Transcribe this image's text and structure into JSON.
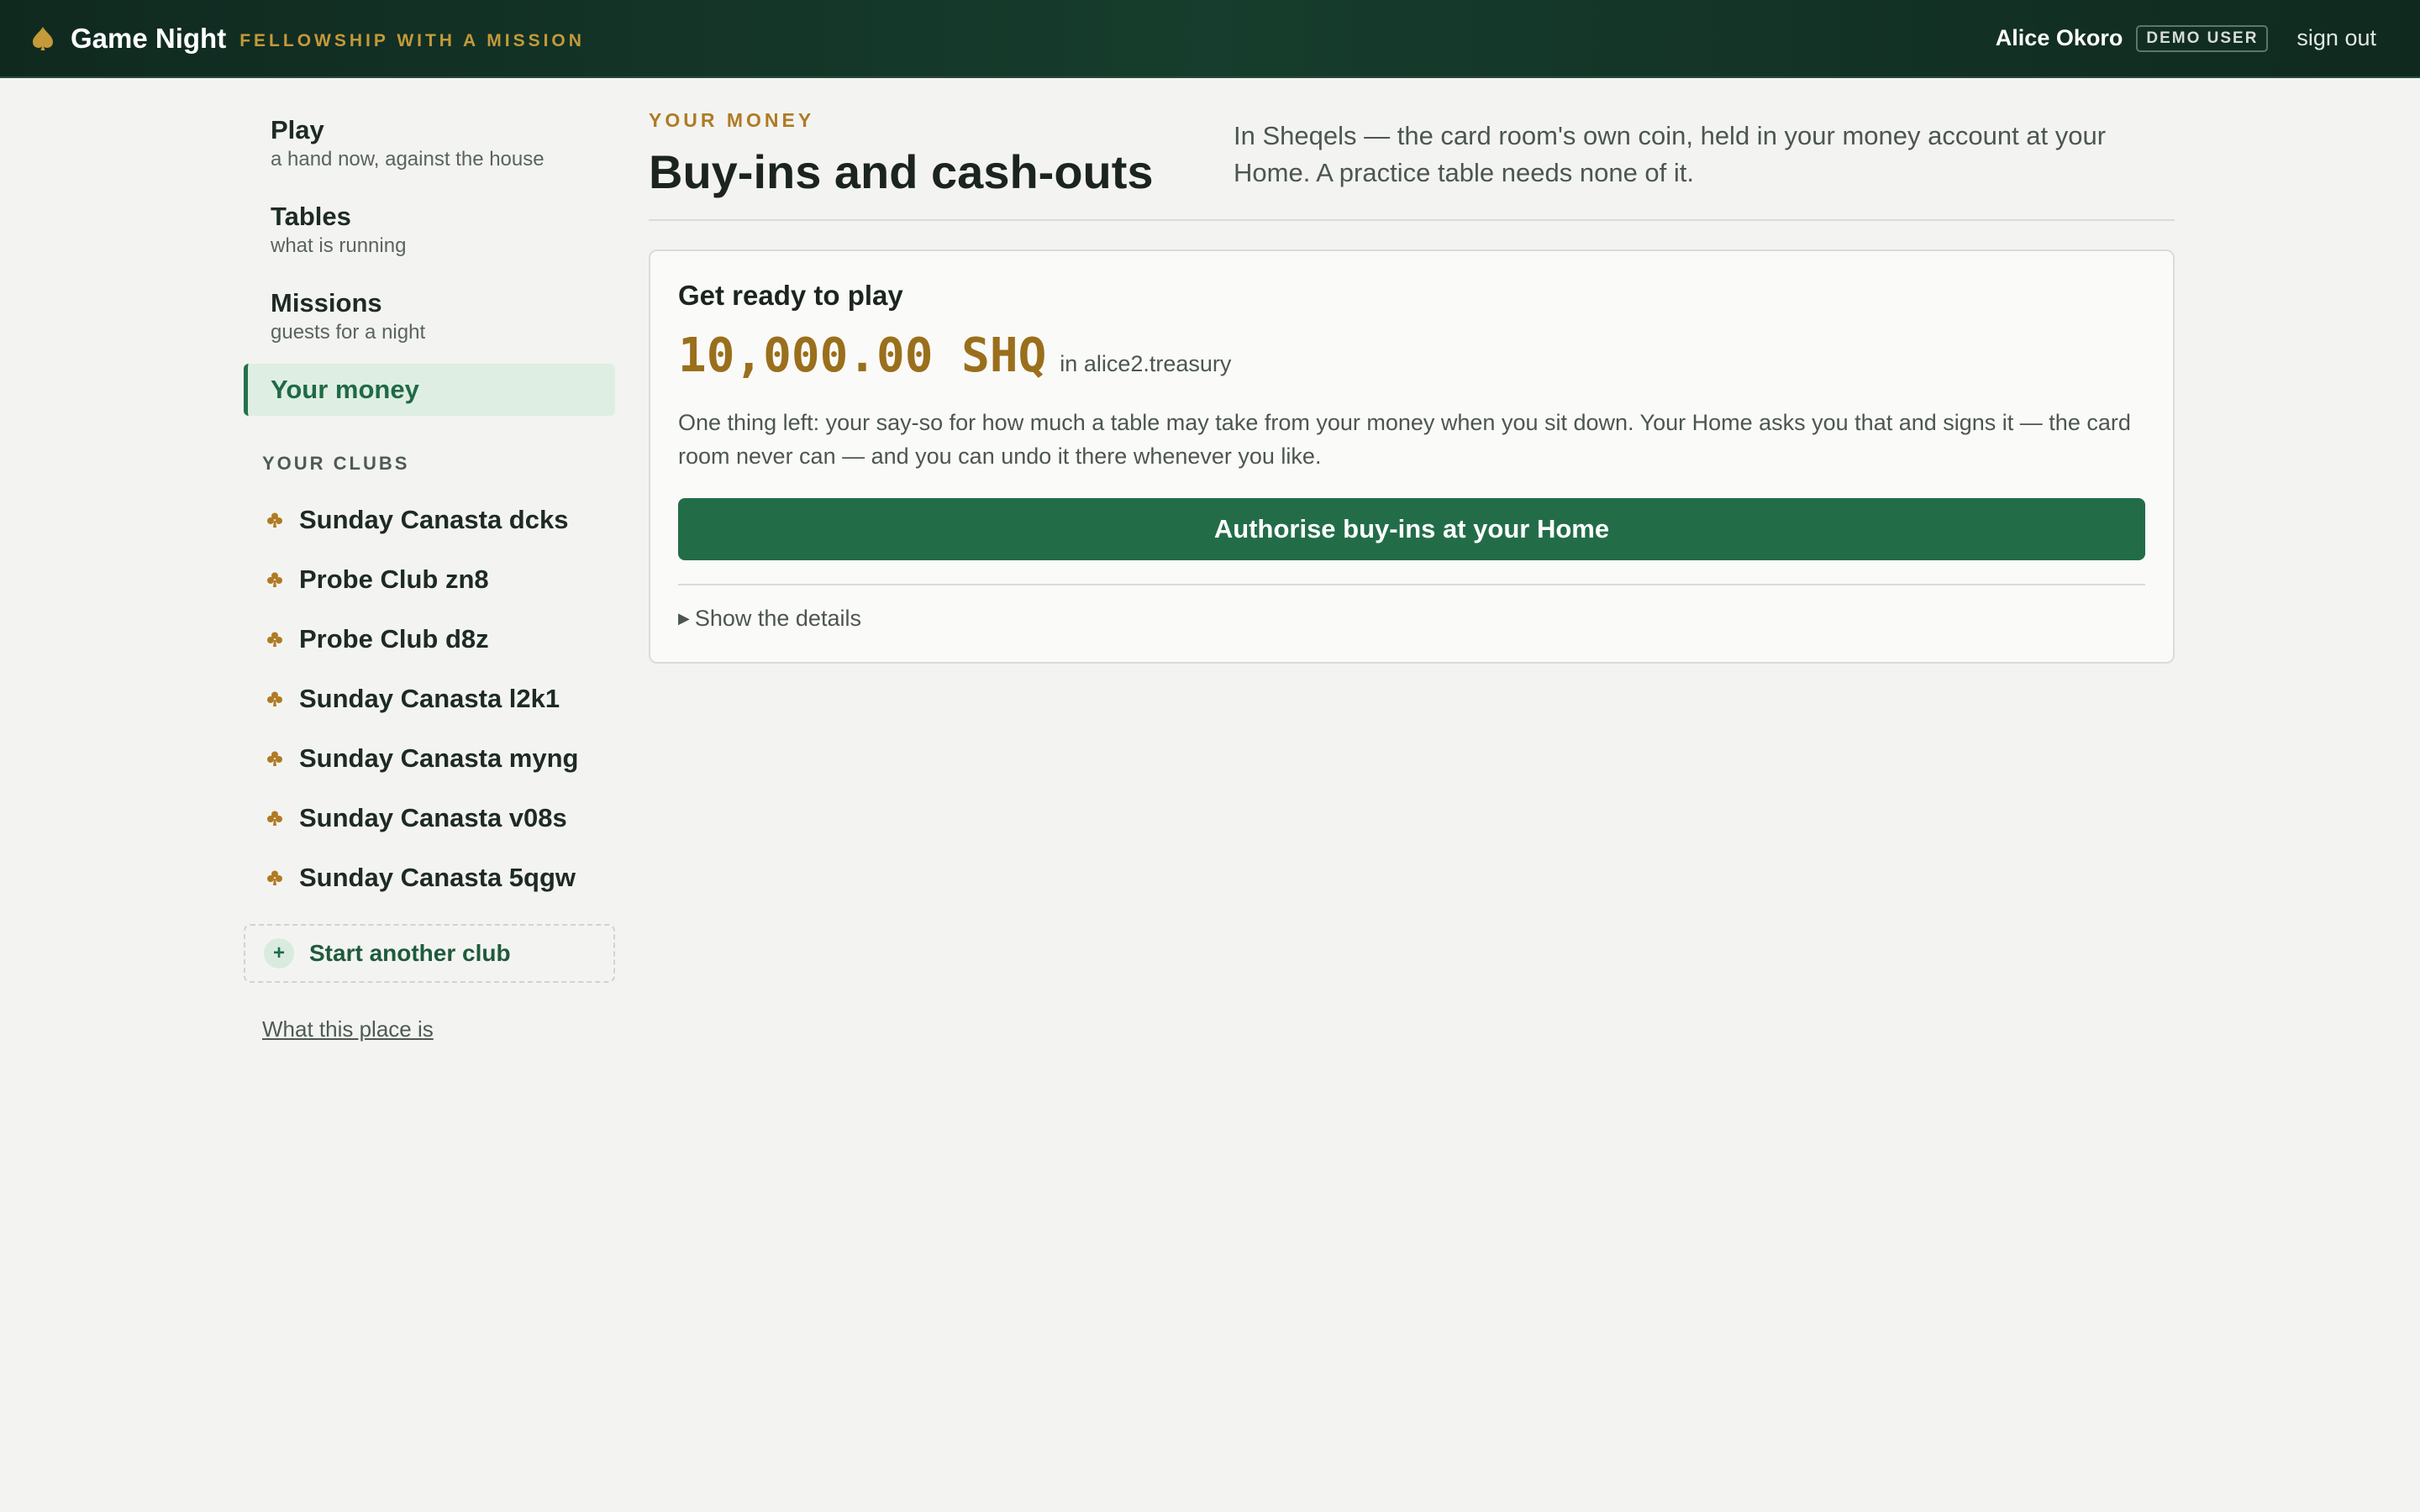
{
  "header": {
    "brand_name": "Game Night",
    "tagline": "FELLOWSHIP WITH A MISSION",
    "user_name": "Alice Okoro",
    "user_badge": "DEMO USER",
    "signout_label": "sign out"
  },
  "sidebar": {
    "nav": [
      {
        "title": "Play",
        "sub": "a hand now, against the house"
      },
      {
        "title": "Tables",
        "sub": "what is running"
      },
      {
        "title": "Missions",
        "sub": "guests for a night"
      },
      {
        "title": "Your money"
      }
    ],
    "clubs_heading": "YOUR CLUBS",
    "clubs": [
      "Sunday Canasta dcks",
      "Probe Club zn8",
      "Probe Club d8z",
      "Sunday Canasta l2k1",
      "Sunday Canasta myng",
      "Sunday Canasta v08s",
      "Sunday Canasta 5qgw"
    ],
    "new_club_label": "Start another club",
    "about_link": "What this place is"
  },
  "main": {
    "eyebrow": "YOUR MONEY",
    "title": "Buy-ins and cash-outs",
    "intro": "In Sheqels — the card room's own coin, held in your money account at your Home. A practice table needs none of it.",
    "card": {
      "title": "Get ready to play",
      "balance": "10,000.00 SHQ",
      "account": "in alice2.treasury",
      "text": "One thing left: your say-so for how much a table may take from your money when you sit down. Your Home asks you that and signs it — the card room never can — and you can undo it there whenever you like.",
      "button_label": "Authorise buy-ins at your Home",
      "details_label": "Show the details"
    }
  },
  "icons": {
    "brand": "spade-icon",
    "club": "club-icon",
    "add": "plus-icon",
    "details": "caret-right-icon"
  },
  "colors": {
    "header_bg": "#163d2d",
    "accent_gold": "#b07a24",
    "primary_green": "#226d48",
    "page_bg": "#f3f4f1"
  }
}
